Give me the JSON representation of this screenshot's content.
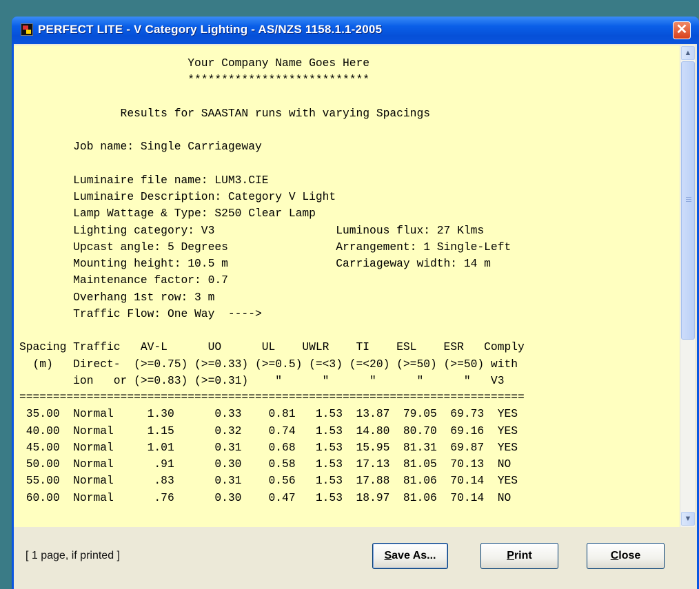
{
  "window": {
    "title": "PERFECT LITE - V Category Lighting - AS/NZS 1158.1.1-2005",
    "close_glyph": "✕",
    "icon": "app-icon"
  },
  "report": {
    "lines": [
      "                         Your Company Name Goes Here",
      "                         ***************************",
      "",
      "               Results for SAASTAN runs with varying Spacings",
      "",
      "        Job name: Single Carriageway",
      "",
      "        Luminaire file name: LUM3.CIE",
      "        Luminaire Description: Category V Light",
      "        Lamp Wattage & Type: S250 Clear Lamp",
      "        Lighting category: V3                  Luminous flux: 27 Klms",
      "        Upcast angle: 5 Degrees                Arrangement: 1 Single-Left",
      "        Mounting height: 10.5 m                Carriageway width: 14 m",
      "        Maintenance factor: 0.7",
      "        Overhang 1st row: 3 m",
      "        Traffic Flow: One Way  ---->",
      "",
      "Spacing Traffic   AV-L      UO      UL    UWLR    TI    ESL    ESR   Comply",
      "  (m)   Direct-  (>=0.75) (>=0.33) (>=0.5) (=<3) (=<20) (>=50) (>=50) with",
      "        ion   or (>=0.83) (>=0.31)    \"      \"      \"      \"      \"   V3",
      "===========================================================================",
      " 35.00  Normal     1.30      0.33    0.81   1.53  13.87  79.05  69.73  YES",
      " 40.00  Normal     1.15      0.32    0.74   1.53  14.80  80.70  69.16  YES",
      " 45.00  Normal     1.01      0.31    0.68   1.53  15.95  81.31  69.87  YES",
      " 50.00  Normal      .91      0.30    0.58   1.53  17.13  81.05  70.13  NO",
      " 55.00  Normal      .83      0.31    0.56   1.53  17.88  81.06  70.14  YES",
      " 60.00  Normal      .76      0.30    0.47   1.53  18.97  81.06  70.14  NO"
    ]
  },
  "scrollbar": {
    "up_icon": "▲",
    "down_icon": "▼"
  },
  "footer": {
    "page_info": "[ 1 page, if printed ]",
    "save_as": {
      "mnemonic": "S",
      "rest": "ave As..."
    },
    "print": {
      "mnemonic": "P",
      "rest": "rint"
    },
    "close": {
      "mnemonic": "C",
      "rest": "lose"
    }
  },
  "colors": {
    "report_background": "#ffffc0",
    "titlebar": "#0a5fe8",
    "close_button": "#d83f1b",
    "desktop": "#3a7b86"
  }
}
